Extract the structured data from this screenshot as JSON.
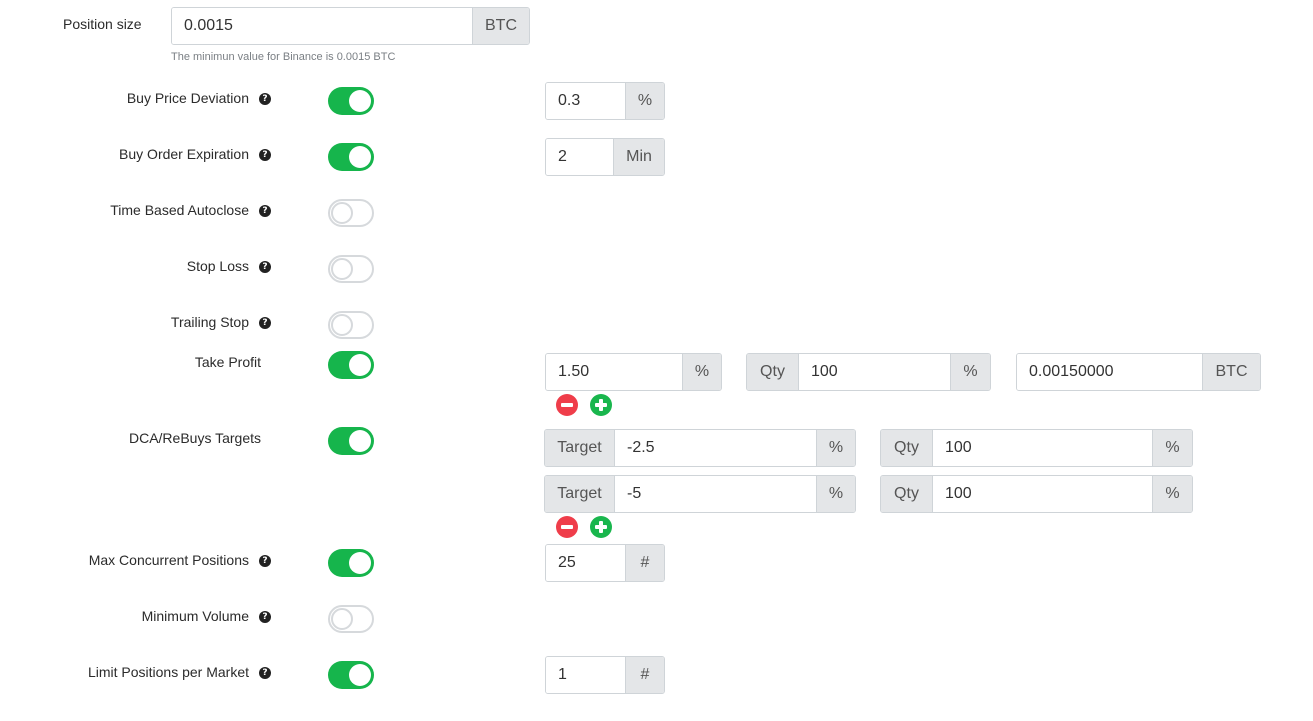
{
  "position_size": {
    "label": "Position size",
    "value": "0.0015",
    "unit": "BTC",
    "hint": "The minimun value for Binance is 0.0015 BTC"
  },
  "settings": [
    {
      "label": "Buy Price Deviation",
      "help_icon": "question-circle-icon",
      "enabled": true,
      "value": "0.3",
      "unit": "%"
    },
    {
      "label": "Buy Order Expiration",
      "help_icon": "question-circle-icon",
      "enabled": true,
      "value": "2",
      "unit": "Min"
    },
    {
      "label": "Time Based Autoclose",
      "help_icon": "question-circle-icon",
      "enabled": false
    },
    {
      "label": "Stop Loss",
      "help_icon": "question-circle-icon",
      "enabled": false
    },
    {
      "label": "Trailing Stop",
      "help_icon": "question-circle-icon",
      "enabled": false
    },
    {
      "label": "Max Concurrent Positions",
      "help_icon": "question-circle-icon",
      "enabled": true,
      "value": "25",
      "unit": "#"
    },
    {
      "label": "Minimum Volume",
      "help_icon": "question-circle-icon",
      "enabled": false
    },
    {
      "label": "Limit Positions per Market",
      "help_icon": "question-circle-icon",
      "enabled": true,
      "value": "1",
      "unit": "#"
    }
  ],
  "take_profit": {
    "label": "Take Profit",
    "enabled": true,
    "percent_value": "1.50",
    "percent_unit": "%",
    "qty_label": "Qty",
    "qty_value": "100",
    "qty_unit": "%",
    "amount_value": "0.00150000",
    "amount_unit": "BTC"
  },
  "dca": {
    "label": "DCA/ReBuys Targets",
    "enabled": true,
    "targets": [
      {
        "target_label": "Target",
        "target_value": "-2.5",
        "target_unit": "%",
        "qty_label": "Qty",
        "qty_value": "100",
        "qty_unit": "%"
      },
      {
        "target_label": "Target",
        "target_value": "-5",
        "target_unit": "%",
        "qty_label": "Qty",
        "qty_value": "100",
        "qty_unit": "%"
      }
    ]
  },
  "icons": {
    "help": "question-circle-icon",
    "remove": "minus-circle-icon",
    "add": "plus-circle-icon"
  },
  "colors": {
    "toggle_on": "#16b54c",
    "remove_button": "#ef3d4a",
    "add_button": "#19b64d"
  }
}
